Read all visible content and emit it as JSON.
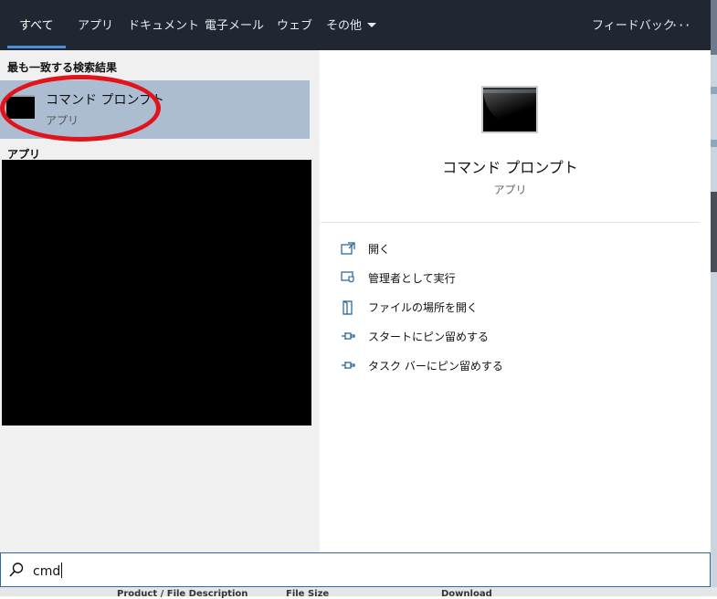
{
  "tabs": [
    {
      "label": "すべて",
      "active": true
    },
    {
      "label": "アプリ"
    },
    {
      "label": "ドキュメント"
    },
    {
      "label": "電子メール"
    },
    {
      "label": "ウェブ"
    },
    {
      "label": "その他",
      "has_dropdown": true
    },
    {
      "label": "フィードバック"
    }
  ],
  "more_label": "···",
  "best_match": {
    "heading": "最も一致する検索結果",
    "title": "コマンド プロンプト",
    "subtitle": "アプリ",
    "icon": "command-prompt-icon",
    "highlight_color": "#e0141c"
  },
  "apps_heading": "アプリ",
  "detail": {
    "title": "コマンド プロンプト",
    "subtitle": "アプリ",
    "icon": "command-prompt-icon",
    "actions": [
      {
        "label": "開く",
        "icon": "open-icon"
      },
      {
        "label": "管理者として実行",
        "icon": "run-as-admin-icon"
      },
      {
        "label": "ファイルの場所を開く",
        "icon": "file-location-icon"
      },
      {
        "label": "スタートにピン留めする",
        "icon": "pin-icon"
      },
      {
        "label": "タスク バーにピン留めする",
        "icon": "pin-icon"
      }
    ]
  },
  "search": {
    "value": "cmd",
    "icon": "search-icon"
  },
  "background_page": {
    "columns": [
      "Product / File Description",
      "File Size",
      "Download"
    ]
  },
  "colors": {
    "topbar": "#202732",
    "accent": "#4a90d9",
    "selected": "#adbdd1"
  }
}
